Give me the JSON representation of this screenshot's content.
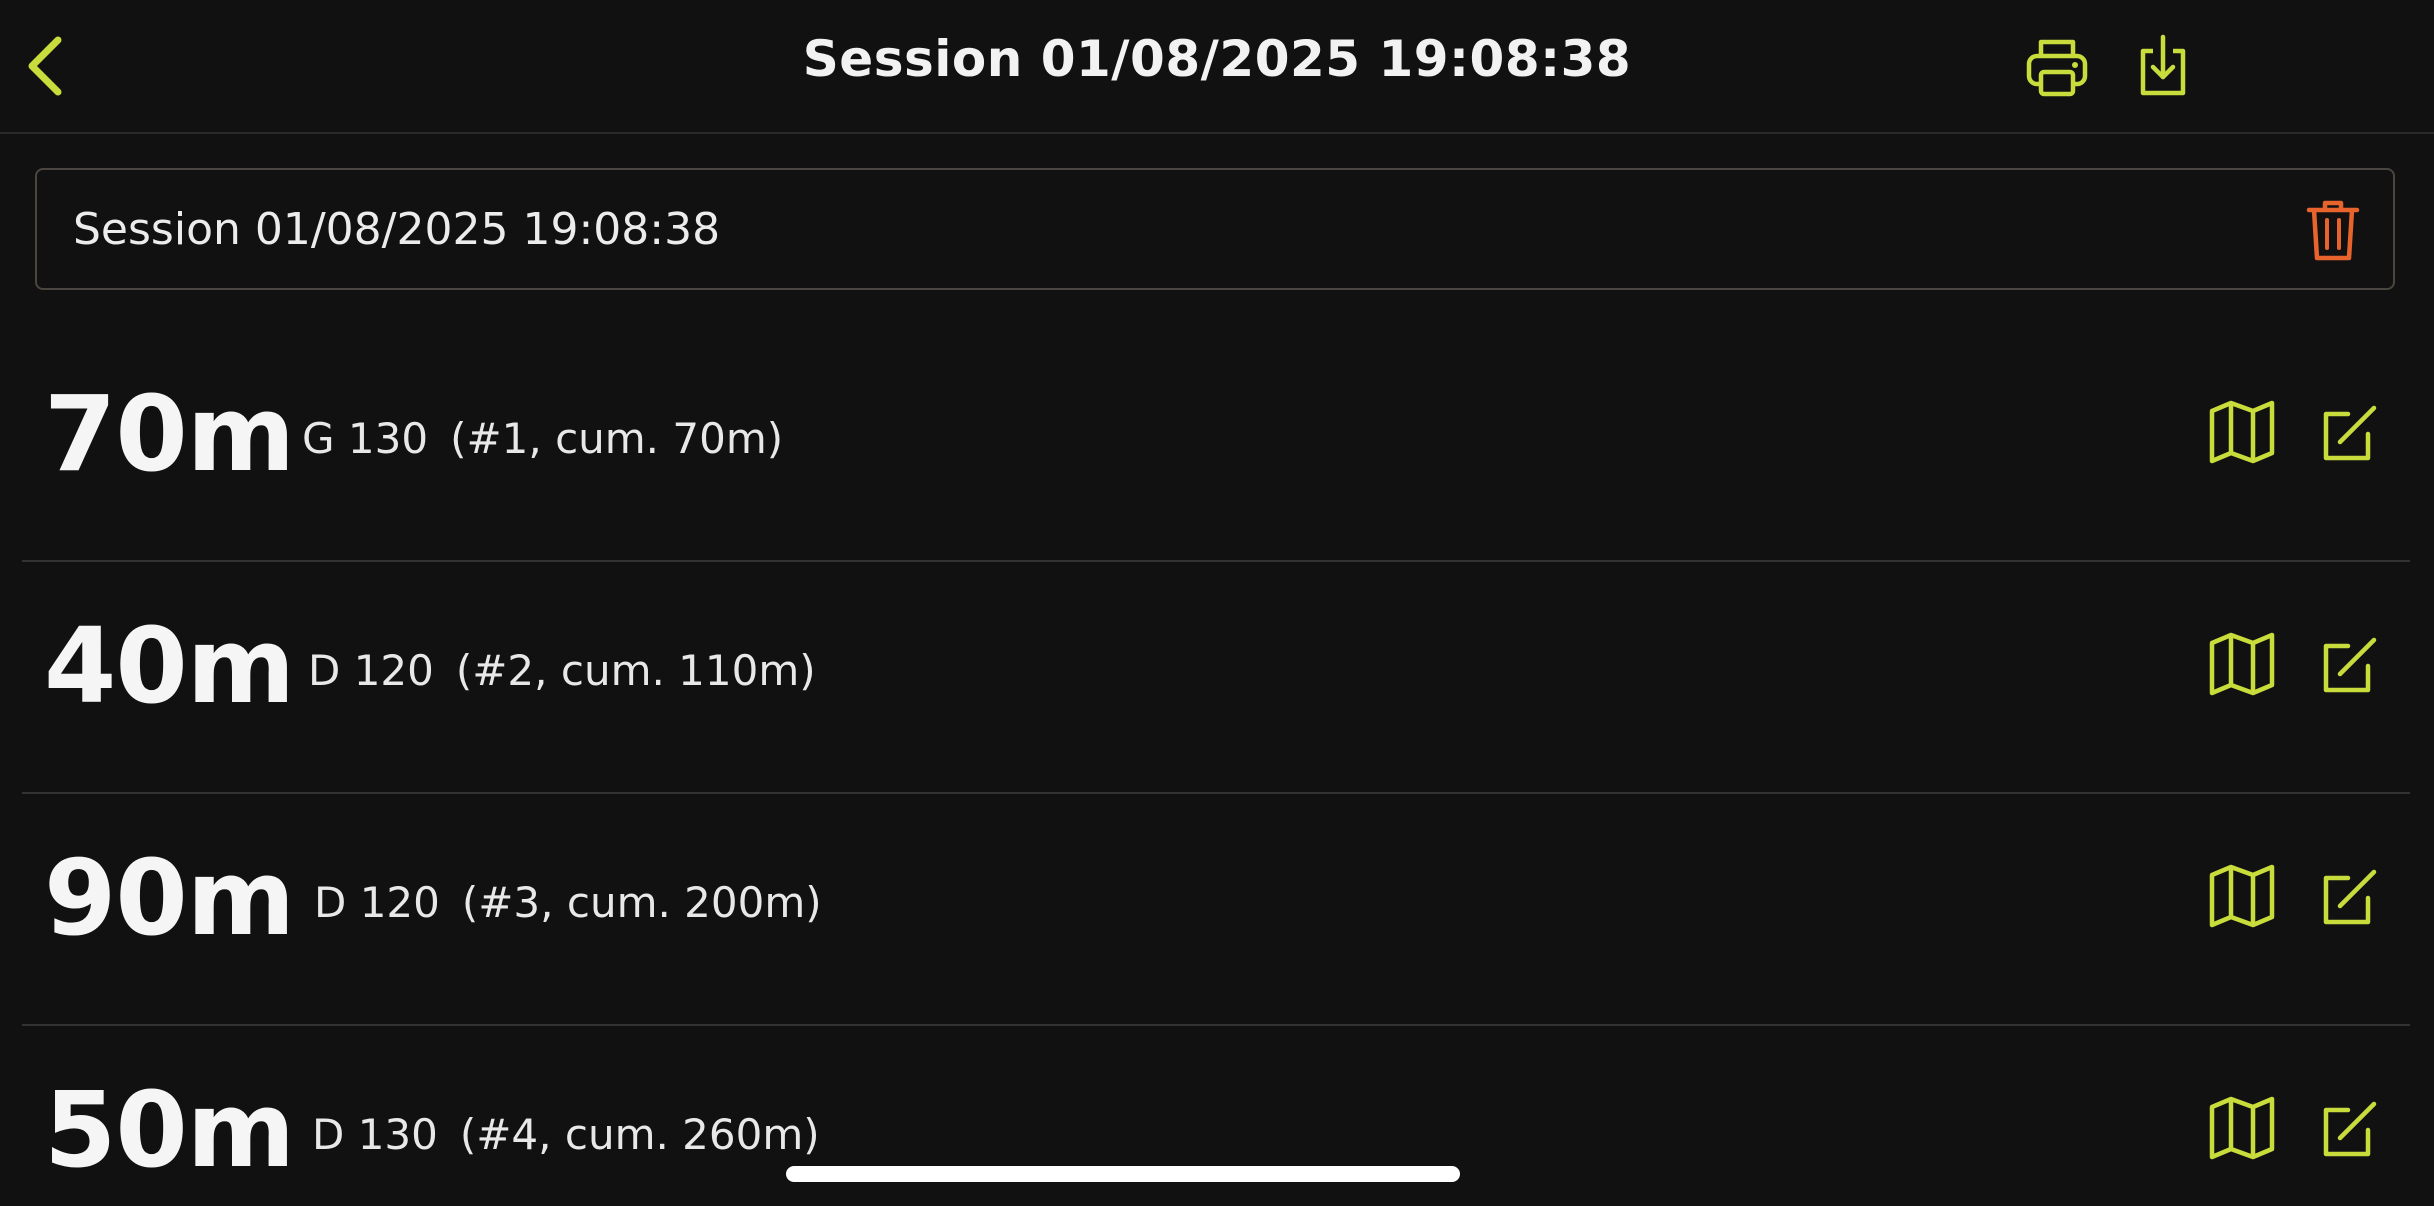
{
  "header": {
    "title": "Session 01/08/2025 19:08:38"
  },
  "session_name": {
    "value": "Session 01/08/2025 19:08:38"
  },
  "shots": [
    {
      "distance": "70m",
      "club": "G 130",
      "info": "(#1, cum. 70m)"
    },
    {
      "distance": "40m",
      "club": "D 120",
      "info": "(#2, cum. 110m)"
    },
    {
      "distance": "90m",
      "club": "D 120",
      "info": "(#3, cum. 200m)"
    },
    {
      "distance": "50m",
      "club": "D 130",
      "info": "(#4, cum. 260m)"
    }
  ],
  "icons": {
    "back": "chevron-left-icon",
    "print": "printer-icon",
    "download": "download-icon",
    "delete": "trash-icon",
    "map": "map-icon",
    "edit": "edit-icon"
  },
  "colors": {
    "background": "#111111",
    "accent": "#c8dc3c",
    "danger": "#e8642c",
    "text": "#f2f2f2",
    "divider": "#333333",
    "field_border": "#4a463f"
  }
}
